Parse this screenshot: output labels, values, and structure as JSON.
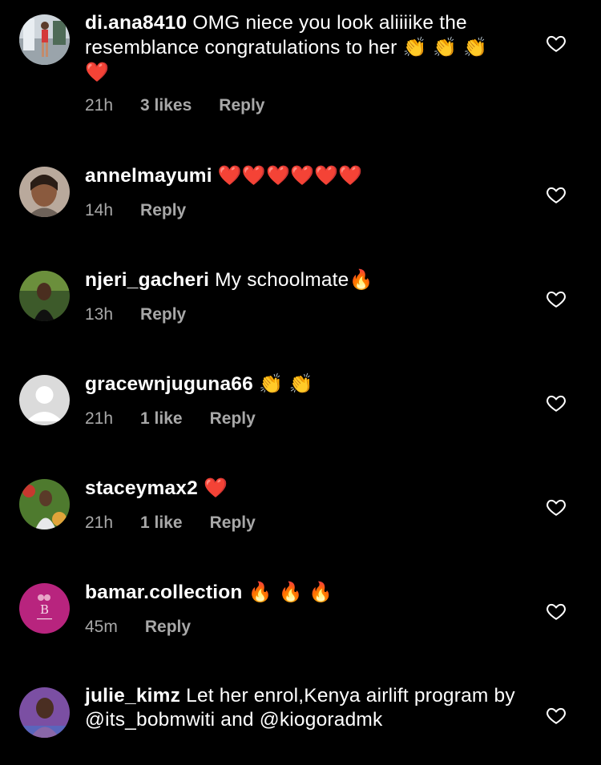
{
  "colors": {
    "background": "#000000",
    "text": "#ffffff",
    "meta": "#a8a8a8",
    "heart": "#e0203a"
  },
  "comments": [
    {
      "username": "di.ana8410",
      "text": "OMG niece you look aliiiike the resemblance congratulations to her",
      "emoji": "👏 👏 👏 ❤️",
      "time": "21h",
      "likes": "3 likes",
      "reply": "Reply",
      "avatar_icon": "avatar-photo-icon"
    },
    {
      "username": "annelmayumi",
      "text": "",
      "emoji": "❤️❤️❤️❤️❤️❤️",
      "time": "14h",
      "likes": "",
      "reply": "Reply",
      "avatar_icon": "avatar-photo-icon"
    },
    {
      "username": "njeri_gacheri",
      "text": "My schoolmate",
      "emoji": "🔥",
      "time": "13h",
      "likes": "",
      "reply": "Reply",
      "avatar_icon": "avatar-photo-icon"
    },
    {
      "username": "gracewnjuguna66",
      "text": "",
      "emoji": "👏 👏",
      "time": "21h",
      "likes": "1 like",
      "reply": "Reply",
      "avatar_icon": "default-avatar-icon"
    },
    {
      "username": "staceymax2",
      "text": "",
      "emoji": "❤️",
      "time": "21h",
      "likes": "1 like",
      "reply": "Reply",
      "avatar_icon": "avatar-photo-icon"
    },
    {
      "username": "bamar.collection",
      "text": "",
      "emoji": "🔥 🔥 🔥",
      "time": "45m",
      "likes": "",
      "reply": "Reply",
      "avatar_icon": "brand-logo-icon"
    },
    {
      "username": "julie_kimz",
      "text": "Let her enrol,Kenya airlift program by @its_bobmwiti and @kiogoradmk",
      "emoji": "",
      "time": "",
      "likes": "",
      "reply": "",
      "avatar_icon": "avatar-photo-icon"
    }
  ]
}
